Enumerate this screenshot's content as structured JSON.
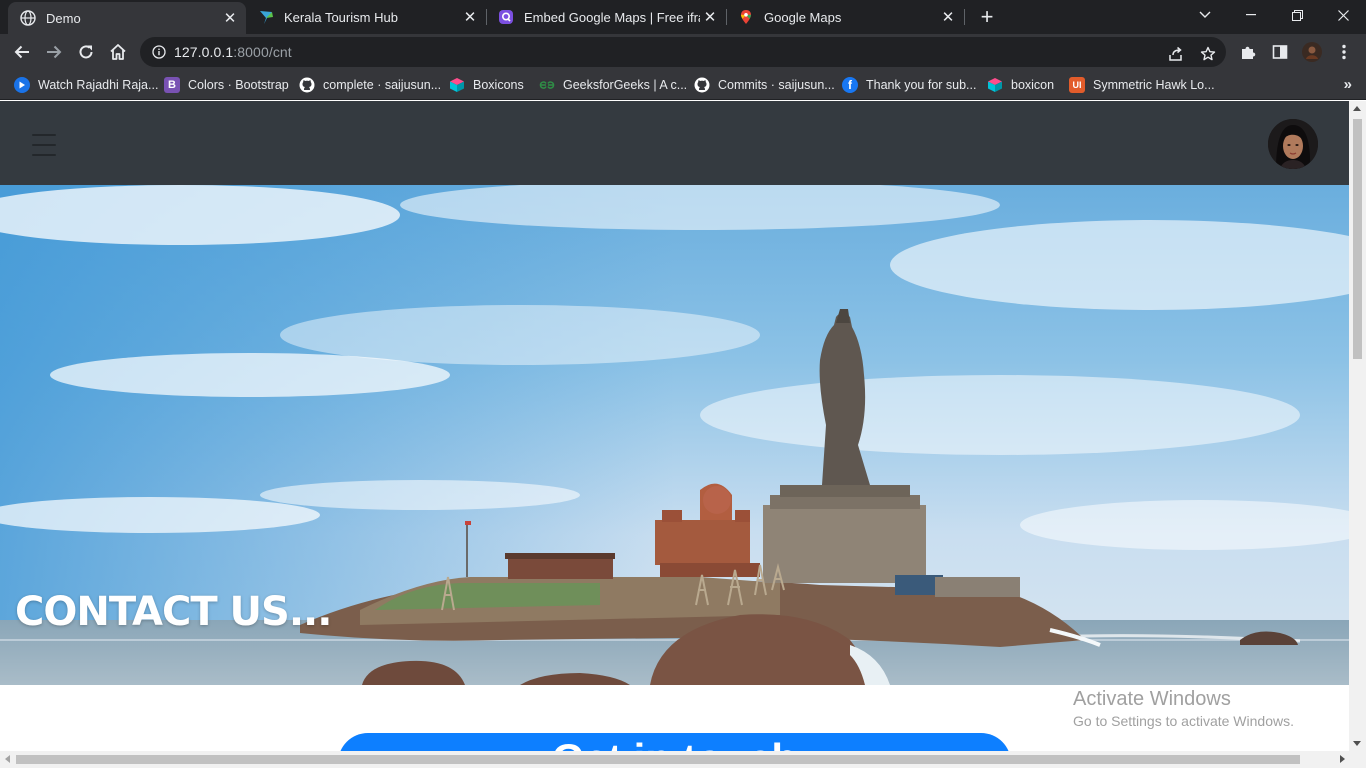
{
  "tabs": [
    {
      "title": "Demo",
      "icon": "globe-icon",
      "active": true
    },
    {
      "title": "Kerala Tourism Hub",
      "icon": "kerala-tourism-icon",
      "active": false
    },
    {
      "title": "Embed Google Maps | Free ifram",
      "icon": "embed-maps-icon",
      "active": false
    },
    {
      "title": "Google Maps",
      "icon": "google-maps-icon",
      "active": false
    }
  ],
  "address_bar": {
    "host": "127.0.0.1",
    "path": ":8000/cnt"
  },
  "bookmarks": [
    {
      "label": "Watch Rajadhi Raja...",
      "icon": "play-icon",
      "color": "#1a73e8"
    },
    {
      "label": "Colors · Bootstrap",
      "icon": "bootstrap-icon",
      "color": "#7952b3"
    },
    {
      "label": "complete · saijusun...",
      "icon": "github-icon",
      "color": "#ffffff"
    },
    {
      "label": "Boxicons",
      "icon": "boxicons-icon",
      "color": "#00b3c4"
    },
    {
      "label": "GeeksforGeeks | A c...",
      "icon": "geeksforgeeks-icon",
      "color": "#2f8d46"
    },
    {
      "label": "Commits · saijusun...",
      "icon": "github-icon",
      "color": "#ffffff"
    },
    {
      "label": "Thank you for sub...",
      "icon": "facebook-icon",
      "color": "#1877f2"
    },
    {
      "label": "boxicon",
      "icon": "boxicons-icon",
      "color": "#00b3c4"
    },
    {
      "label": "Symmetric Hawk Lo...",
      "icon": "uiverse-icon",
      "color": "#e25c2b"
    }
  ],
  "page": {
    "hero_title": "CONTACT US...",
    "cta_label": "Get in touch",
    "navbar_color": "#343a40",
    "cta_color": "#0d7fff"
  },
  "watermark": {
    "line1": "Activate Windows",
    "line2": "Go to Settings to activate Windows."
  }
}
